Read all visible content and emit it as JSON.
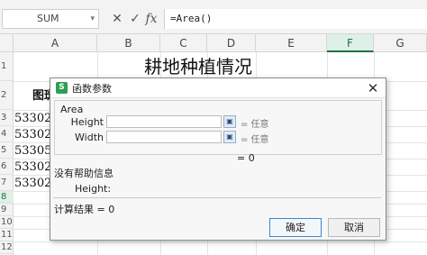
{
  "formula_bar": {
    "name_box": "SUM",
    "name_box_arrow": "▾",
    "cancel_icon": "✕",
    "confirm_icon": "✓",
    "fx_icon": "fx",
    "formula": "=Area()"
  },
  "columns": [
    "A",
    "B",
    "C",
    "D",
    "E",
    "F",
    "G"
  ],
  "rows": [
    "1",
    "2",
    "3",
    "4",
    "5",
    "6",
    "7",
    "8",
    "9",
    "10",
    "11",
    "12"
  ],
  "sheet": {
    "title": "耕地种植情况",
    "col_a_header": "图斑",
    "col_a_values": [
      "53302",
      "53302",
      "53305",
      "53302",
      "53302"
    ]
  },
  "dialog": {
    "title": "函数参数",
    "logo_letter": "S",
    "close_icon": "✕",
    "function_name": "Area",
    "args": [
      {
        "label": "Height",
        "hint": "= 任意",
        "pick_icon": "▣"
      },
      {
        "label": "Width",
        "hint": "= 任意",
        "pick_icon": "▣"
      }
    ],
    "result_inline": "= 0",
    "no_help": "没有帮助信息",
    "help_param": "Height:",
    "calc_result": "计算结果 = 0",
    "ok_label": "确定",
    "cancel_label": "取消"
  }
}
